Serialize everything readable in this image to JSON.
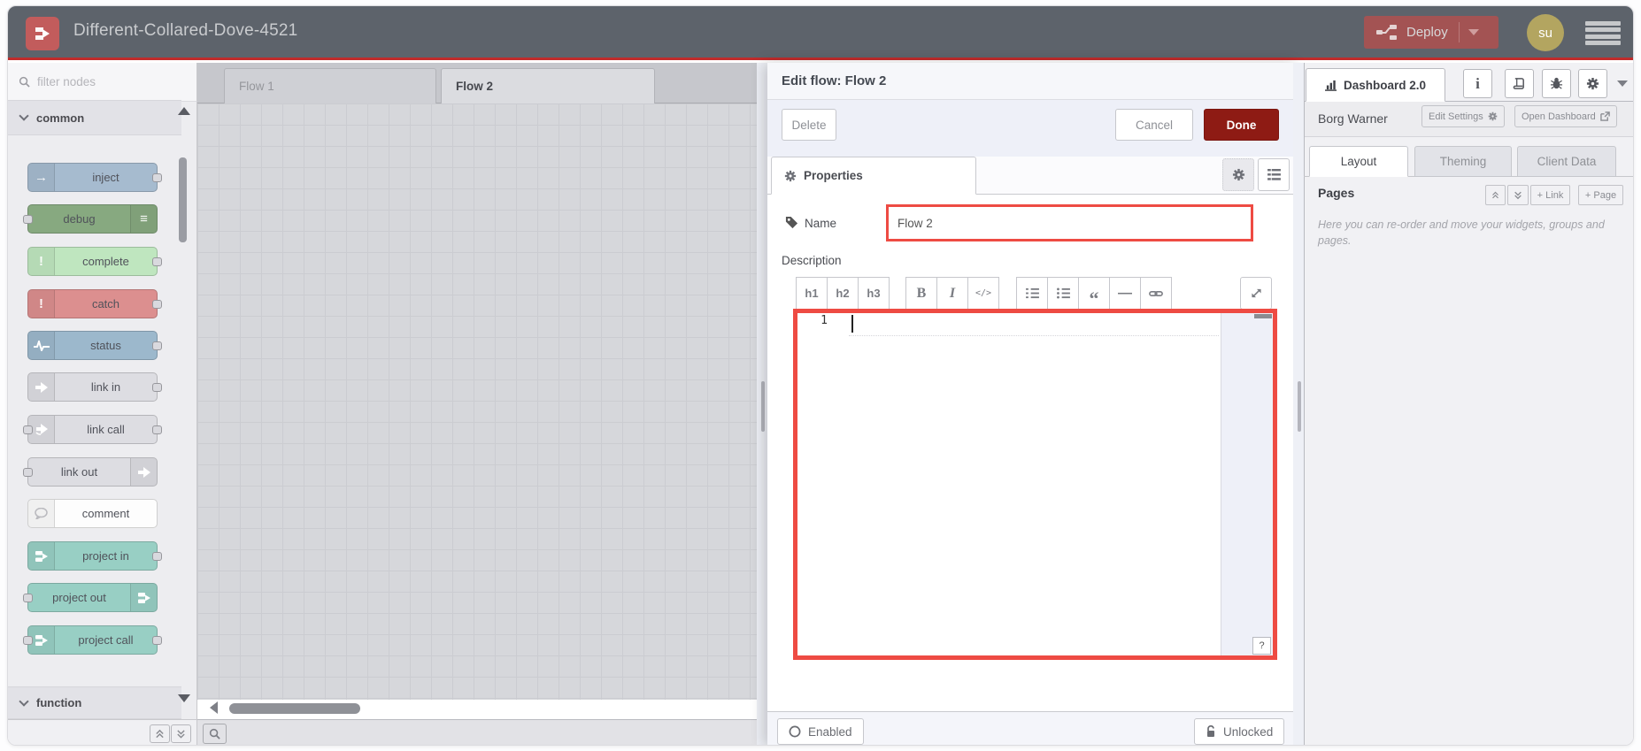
{
  "header": {
    "title": "Different-Collared-Dove-4521",
    "deploy_label": "Deploy",
    "avatar_text": "su"
  },
  "palette": {
    "search_placeholder": "filter nodes",
    "categories": [
      {
        "label": "common"
      },
      {
        "label": "function"
      }
    ],
    "nodes": [
      {
        "label": "inject",
        "color": "#a6bbcf"
      },
      {
        "label": "debug",
        "color": "#87a980"
      },
      {
        "label": "complete",
        "color": "#bfe6bf"
      },
      {
        "label": "catch",
        "color": "#dc8f8f"
      },
      {
        "label": "status",
        "color": "#9cb8cc"
      },
      {
        "label": "link in",
        "color": "#dddde2"
      },
      {
        "label": "link call",
        "color": "#dddde2"
      },
      {
        "label": "link out",
        "color": "#dddde2"
      },
      {
        "label": "comment",
        "color": "#fdfdfd"
      },
      {
        "label": "project in",
        "color": "#98cfc4"
      },
      {
        "label": "project out",
        "color": "#98cfc4"
      },
      {
        "label": "project call",
        "color": "#98cfc4"
      }
    ]
  },
  "workspace": {
    "tabs": [
      {
        "label": "Flow 1"
      },
      {
        "label": "Flow 2"
      }
    ]
  },
  "tray": {
    "title": "Edit flow: Flow 2",
    "delete_label": "Delete",
    "cancel_label": "Cancel",
    "done_label": "Done",
    "properties_tab": "Properties",
    "name_label": "Name",
    "name_value": "Flow 2",
    "description_label": "Description",
    "toolbar": {
      "h1": "h1",
      "h2": "h2",
      "h3": "h3",
      "bold": "B",
      "italic": "I",
      "code": "</>",
      "quote": "“",
      "hr": "—"
    },
    "editor": {
      "line_number": "1",
      "help_label": "?"
    },
    "footer": {
      "enabled_label": "Enabled",
      "unlocked_label": "Unlocked"
    }
  },
  "sidebar": {
    "dashboard_tab": "Dashboard 2.0",
    "project_name": "Borg Warner",
    "edit_settings_label": "Edit Settings",
    "open_dashboard_label": "Open Dashboard",
    "tabs": [
      {
        "label": "Layout"
      },
      {
        "label": "Theming"
      },
      {
        "label": "Client Data"
      }
    ],
    "pages_title": "Pages",
    "link_button": "+ Link",
    "page_button": "+ Page",
    "help_text": "Here you can re-order and move your widgets, groups and pages."
  },
  "colors": {
    "header_bg": "#5d636b",
    "accent_red_line": "#c02b2b",
    "highlight_red": "#ee4b43",
    "done_red": "#8e1b14",
    "deploy_red": "#a35353",
    "avatar_khaki": "#b3a560"
  }
}
